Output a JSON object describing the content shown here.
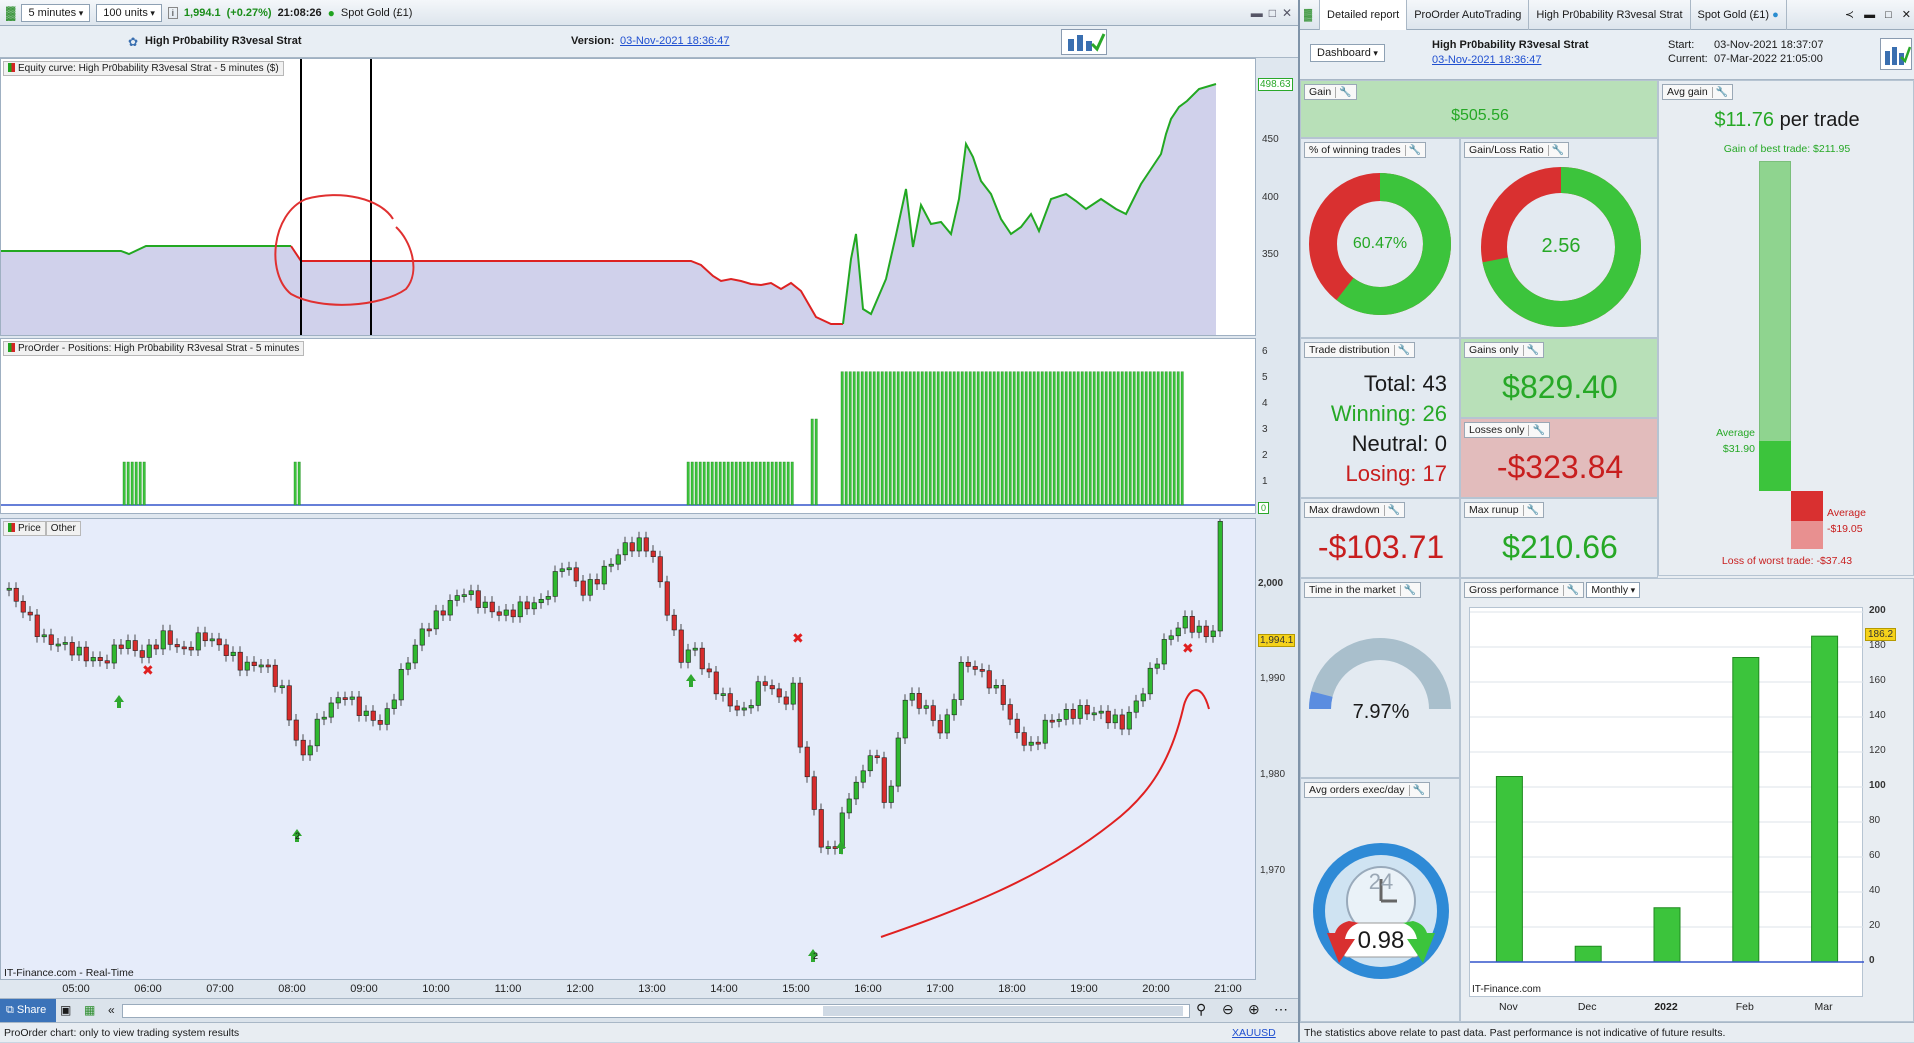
{
  "toolbar": {
    "timeframe": "5 minutes",
    "units": "100 units",
    "price": "1,994.1",
    "change": "(+0.27%)",
    "time": "21:08:26",
    "instrument": "Spot Gold (£1)"
  },
  "strategy_bar": {
    "name": "High Pr0bability R3vesal Strat",
    "version_label": "Version:",
    "version_date": "03-Nov-2021 18:36:47"
  },
  "equity_pane": {
    "label": "Equity curve: High Pr0bability R3vesal Strat - 5 minutes ($)",
    "last_value": "498.63",
    "y_ticks": [
      "450",
      "400",
      "350"
    ]
  },
  "positions_pane": {
    "label": "ProOrder - Positions: High Pr0bability R3vesal Strat - 5 minutes",
    "y_ticks": [
      "6",
      "5",
      "4",
      "3",
      "2",
      "1"
    ],
    "zero_tag": "0"
  },
  "price_pane": {
    "tab_price": "Price",
    "tab_other": "Other",
    "last_price": "1,994.1",
    "y_ticks": [
      "2,000",
      "1,990",
      "1,980",
      "1,970"
    ],
    "source": "IT-Finance.com - Real-Time",
    "marker_count_1": "2",
    "marker_count_2": "2"
  },
  "time_axis": [
    "05:00",
    "06:00",
    "07:00",
    "08:00",
    "09:00",
    "10:00",
    "11:00",
    "12:00",
    "13:00",
    "14:00",
    "15:00",
    "16:00",
    "17:00",
    "18:00",
    "19:00",
    "20:00",
    "21:00"
  ],
  "bottom": {
    "share": "Share",
    "status": "ProOrder chart: only to view trading system results",
    "symbol": "XAUUSD"
  },
  "right_tabs": [
    "Detailed report",
    "ProOrder AutoTrading",
    "High Pr0bability R3vesal Strat",
    "Spot Gold (£1)"
  ],
  "report_header": {
    "dashboard": "Dashboard",
    "name": "High Pr0bability R3vesal Strat",
    "date": "03-Nov-2021 18:36:47",
    "start_label": "Start:",
    "start": "03-Nov-2021 18:37:07",
    "current_label": "Current:",
    "current": "07-Mar-2022 21:05:00"
  },
  "tiles": {
    "gain": {
      "label": "Gain",
      "value": "$505.56"
    },
    "avg_gain": {
      "label": "Avg gain",
      "value": "$11.76",
      "suffix": "per trade",
      "best": "Gain of best trade: $211.95",
      "avg_label": "Average",
      "avg_value": "$31.90",
      "loss_avg_label": "Average",
      "loss_avg_value": "-$19.05",
      "worst": "Loss of worst trade: -$37.43"
    },
    "winning_pct": {
      "label": "% of winning trades",
      "value": "60.47%",
      "fraction": 0.6047
    },
    "gain_loss_ratio": {
      "label": "Gain/Loss Ratio",
      "value": "2.56",
      "fraction": 0.719
    },
    "trade_distribution": {
      "label": "Trade distribution",
      "total": "Total: 43",
      "winning": "Winning: 26",
      "neutral": "Neutral: 0",
      "losing": "Losing: 17"
    },
    "gains_only": {
      "label": "Gains only",
      "value": "$829.40"
    },
    "losses_only": {
      "label": "Losses only",
      "value": "-$323.84"
    },
    "max_drawdown": {
      "label": "Max drawdown",
      "value": "-$103.71"
    },
    "max_runup": {
      "label": "Max runup",
      "value": "$210.66"
    },
    "time_in_market": {
      "label": "Time in the market",
      "value": "7.97%",
      "fraction": 0.0797
    },
    "avg_orders": {
      "label": "Avg orders exec/day",
      "value": "0.98",
      "clock_number": "24"
    },
    "gross_performance": {
      "label": "Gross performance",
      "period": "Monthly",
      "source": "IT-Finance.com",
      "last_tag": "186.2"
    }
  },
  "disclaimer": "The statistics above relate to past data. Past performance is not indicative of future results.",
  "chart_data": {
    "type": "bar",
    "categories": [
      "Nov",
      "Dec",
      "2022",
      "Feb",
      "Mar"
    ],
    "values": [
      106,
      9,
      31,
      174,
      186.2
    ],
    "ylim": [
      0,
      200
    ],
    "y_ticks": [
      "200",
      "180",
      "160",
      "140",
      "120",
      "100",
      "80",
      "60",
      "40",
      "20",
      "0"
    ],
    "grid": true
  },
  "colors": {
    "green": "#3cc43c",
    "red": "#d93030",
    "blue_line": "#3355cc",
    "equity_fill": "#cfd0ea"
  }
}
